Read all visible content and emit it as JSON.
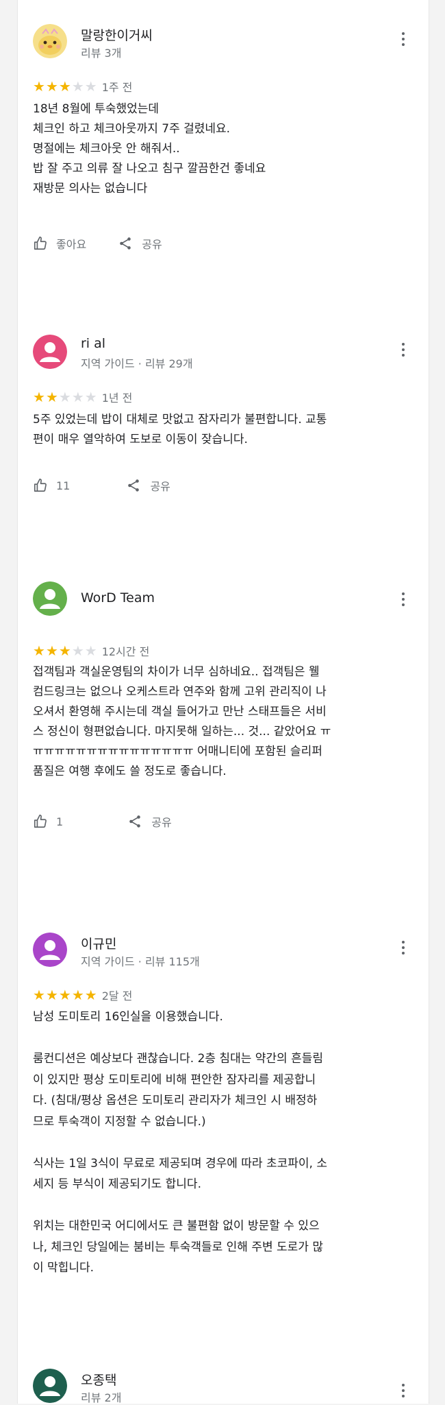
{
  "theme": {
    "star_filled": "#f4b400",
    "star_empty": "#dadce0",
    "muted_text": "#70757a"
  },
  "reviews": [
    {
      "avatar_icon": "yellow-chick-avatar-icon",
      "avatar_color": "#f6df8a",
      "author": "말랑한이거씨",
      "subtitle": "리뷰 3개",
      "rating": 3,
      "rating_max": 5,
      "time": "1주 전",
      "text": "18년 8월에 투숙했었는데\n체크인 하고 체크아웃까지 7주 걸렸네요.\n명절에는 체크아웃 안 해줘서..\n밥 잘 주고 의류 잘 나오고 침구 깔끔한건 좋네요\n재방문 의사는 없습니다",
      "like_label": "좋아요",
      "share_label": "공유"
    },
    {
      "avatar_icon": "person-avatar-icon",
      "avatar_color": "#e64a7a",
      "author": "ri al",
      "subtitle": "지역 가이드 · 리뷰 29개",
      "rating": 2,
      "rating_max": 5,
      "time": "1년 전",
      "text": "5주 있었는데 밥이 대체로 맛없고 잠자리가 불편합니다. 교통\n편이 매우 열악하여 도보로 이동이 잦습니다.",
      "like_label": "11",
      "share_label": "공유"
    },
    {
      "avatar_icon": "person-avatar-icon",
      "avatar_color": "#64b04b",
      "author": "WorD Team",
      "subtitle": "",
      "rating": 3,
      "rating_max": 5,
      "time": "12시간 전",
      "text": "접객팀과 객실운영팀의 차이가 너무 심하네요.. 접객팀은 웰\n컴드링크는 없으나 오케스트라 연주와 함께 고위 관리직이 나\n오셔서 환영해 주시는데 객실 들어가고 만난 스태프들은 서비\n스 정신이 형편없습니다. 마지못해 일하는... 것... 같았어요 ㅠ\nㅠㅠㅠㅠㅠㅠㅠㅠㅠㅠㅠㅠㅠㅠㅠ 어매니티에 포함된 슬리퍼\n품질은 여행 후에도 쓸 정도로 좋습니다.",
      "like_label": "1",
      "share_label": "공유"
    },
    {
      "avatar_icon": "person-avatar-icon",
      "avatar_color": "#a945c9",
      "author": "이규민",
      "subtitle": "지역 가이드 · 리뷰 115개",
      "rating": 5,
      "rating_max": 5,
      "time": "2달 전",
      "text": "남성 도미토리 16인실을 이용했습니다.\n\n룸컨디션은 예상보다 괜찮습니다. 2층 침대는 약간의 흔들림\n이 있지만 평상 도미토리에 비해 편안한 잠자리를 제공합니\n다. (침대/평상 옵션은 도미토리 관리자가 체크인 시 배정하\n므로 투숙객이 지정할 수 없습니다.)\n\n식사는 1일 3식이 무료로 제공되며 경우에 따라 초코파이, 소\n세지 등 부식이 제공되기도 합니다.\n\n위치는 대한민국 어디에서도 큰 불편함 없이 방문할 수 있으\n나, 체크인 당일에는 붐비는 투숙객들로 인해 주변 도로가 많\n이 막힙니다.",
      "like_label": "",
      "share_label": ""
    },
    {
      "avatar_icon": "person-avatar-icon",
      "avatar_color": "#1e5f4e",
      "author": "오종택",
      "subtitle": "리뷰 2개",
      "rating": 0,
      "rating_max": 5,
      "time": "",
      "text": "",
      "like_label": "",
      "share_label": ""
    }
  ]
}
